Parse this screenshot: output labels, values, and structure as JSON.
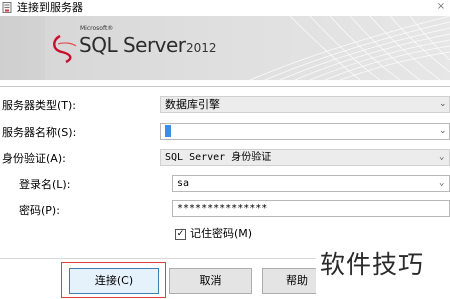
{
  "window": {
    "title": "连接到服务器",
    "close_label": "×"
  },
  "banner": {
    "microsoft_label": "Microsoft®",
    "product_name": "SQL Server",
    "product_version": "2012"
  },
  "form": {
    "server_type": {
      "label": "服务器类型(T):",
      "value": "数据库引擎"
    },
    "server_name": {
      "label": "服务器名称(S):",
      "value": ""
    },
    "authentication": {
      "label": "身份验证(A):",
      "value": "SQL Server 身份验证"
    },
    "login": {
      "label": "登录名(L):",
      "value": "sa"
    },
    "password": {
      "label": "密码(P):",
      "value": "***************"
    },
    "remember_password": {
      "label": "记住密码(M)",
      "checked": true
    }
  },
  "buttons": {
    "connect": "连接(C)",
    "cancel": "取消",
    "help": "帮助"
  },
  "watermark": {
    "text": "软件技巧"
  },
  "colors": {
    "highlight_box": "#e63c3c",
    "banner_bg": "#d6d6d6",
    "selection_caret": "#3a8ee6"
  },
  "icons": {
    "window_icon": "server-connect-icon",
    "dropdown_arrow": "chevron-down-icon"
  }
}
